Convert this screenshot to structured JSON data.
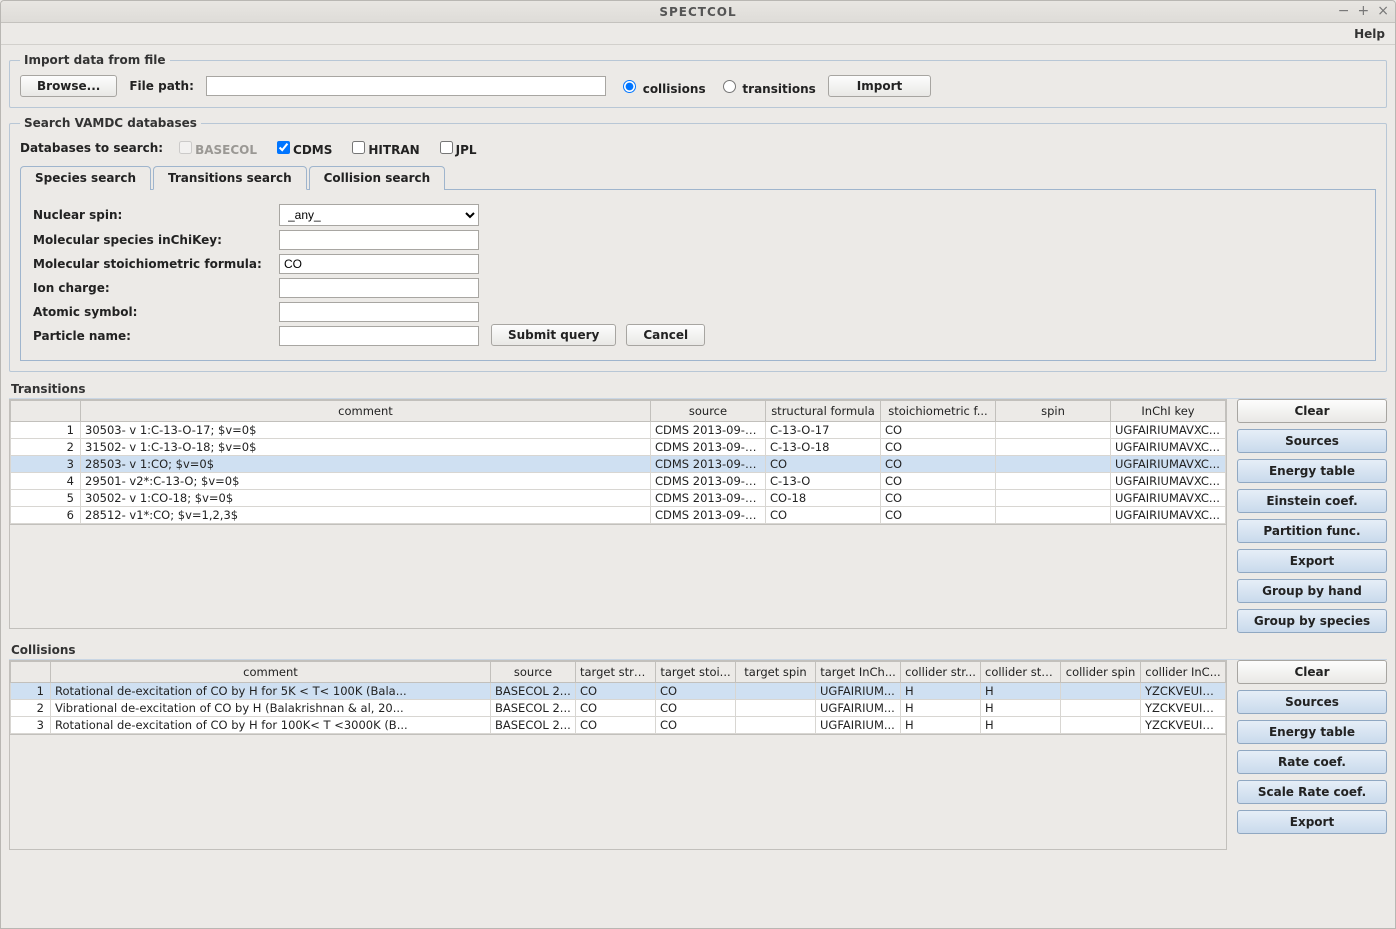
{
  "window": {
    "title": "SPECTCOL"
  },
  "menu": {
    "help": "Help"
  },
  "import_panel": {
    "legend": "Import data from file",
    "browse": "Browse...",
    "file_path_label": "File path:",
    "file_path_value": "",
    "radio_collisions": "collisions",
    "radio_transitions": "transitions",
    "import": "Import"
  },
  "search_panel": {
    "legend": "Search VAMDC databases",
    "db_label": "Databases to search:",
    "db": {
      "basecol": "BASECOL",
      "cdms": "CDMS",
      "hitran": "HITRAN",
      "jpl": "JPL"
    },
    "tabs": {
      "species": "Species search",
      "transitions": "Transitions search",
      "collision": "Collision search"
    },
    "form": {
      "nuclear_spin": "Nuclear spin:",
      "nuclear_spin_value": "_any_",
      "inchikey": "Molecular species inChiKey:",
      "inchikey_value": "",
      "stoich": "Molecular stoichiometric formula:",
      "stoich_value": "CO",
      "ion_charge": "Ion charge:",
      "ion_charge_value": "",
      "atomic_symbol": "Atomic symbol:",
      "atomic_symbol_value": "",
      "particle_name": "Particle name:",
      "particle_name_value": "",
      "submit": "Submit query",
      "cancel": "Cancel"
    }
  },
  "transitions": {
    "heading": "Transitions",
    "columns": [
      "",
      "comment",
      "source",
      "structural formula",
      "stoichiometric f...",
      "spin",
      "InChI key"
    ],
    "rows": [
      {
        "n": "1",
        "comment": "30503- v 1:C-13-O-17; $v=0$",
        "source": "CDMS 2013-09-0...",
        "structural": "C-13-O-17",
        "stoich": "CO",
        "spin": "",
        "inchi": "UGFAIRIUMAVXC..."
      },
      {
        "n": "2",
        "comment": "31502- v 1:C-13-O-18; $v=0$",
        "source": "CDMS 2013-09-0...",
        "structural": "C-13-O-18",
        "stoich": "CO",
        "spin": "",
        "inchi": "UGFAIRIUMAVXC..."
      },
      {
        "n": "3",
        "comment": "28503- v 1:CO; $v=0$",
        "source": "CDMS 2013-09-0...",
        "structural": "CO",
        "stoich": "CO",
        "spin": "",
        "inchi": "UGFAIRIUMAVXC...",
        "selected": true
      },
      {
        "n": "4",
        "comment": "29501- v2*:C-13-O; $v=0$",
        "source": "CDMS 2013-09-0...",
        "structural": "C-13-O",
        "stoich": "CO",
        "spin": "",
        "inchi": "UGFAIRIUMAVXC..."
      },
      {
        "n": "5",
        "comment": "30502- v 1:CO-18; $v=0$",
        "source": "CDMS 2013-09-0...",
        "structural": "CO-18",
        "stoich": "CO",
        "spin": "",
        "inchi": "UGFAIRIUMAVXC..."
      },
      {
        "n": "6",
        "comment": "28512- v1*:CO; $v=1,2,3$",
        "source": "CDMS 2013-09-0...",
        "structural": "CO",
        "stoich": "CO",
        "spin": "",
        "inchi": "UGFAIRIUMAVXC..."
      }
    ],
    "buttons": {
      "clear": "Clear",
      "sources": "Sources",
      "energy": "Energy table",
      "einstein": "Einstein coef.",
      "partition": "Partition func.",
      "export": "Export",
      "group_hand": "Group by hand",
      "group_species": "Group by species"
    }
  },
  "collisions": {
    "heading": "Collisions",
    "columns": [
      "",
      "comment",
      "source",
      "target stru...",
      "target stoi...",
      "target spin",
      "target InCh...",
      "collider str...",
      "collider sto...",
      "collider spin",
      "collider InC..."
    ],
    "rows": [
      {
        "n": "1",
        "comment": "Rotational de-excitation of CO by H for 5K < T< 100K (Bala...",
        "source": "BASECOL 2...",
        "tstru": "CO",
        "tstoi": "CO",
        "tspin": "",
        "tinch": "UGFAIRIUM...",
        "cstru": "H",
        "cstoi": "H",
        "cspin": "",
        "cinch": "YZCKVEUIG...",
        "selected": true
      },
      {
        "n": "2",
        "comment": "Vibrational de-excitation of CO by H (Balakrishnan & al, 20...",
        "source": "BASECOL 2...",
        "tstru": "CO",
        "tstoi": "CO",
        "tspin": "",
        "tinch": "UGFAIRIUM...",
        "cstru": "H",
        "cstoi": "H",
        "cspin": "",
        "cinch": "YZCKVEUIG..."
      },
      {
        "n": "3",
        "comment": "Rotational de-excitation of CO by H for 100K< T <3000K (B...",
        "source": "BASECOL 2...",
        "tstru": "CO",
        "tstoi": "CO",
        "tspin": "",
        "tinch": "UGFAIRIUM...",
        "cstru": "H",
        "cstoi": "H",
        "cspin": "",
        "cinch": "YZCKVEUIG..."
      }
    ],
    "buttons": {
      "clear": "Clear",
      "sources": "Sources",
      "energy": "Energy table",
      "rate": "Rate coef.",
      "scale": "Scale Rate coef.",
      "export": "Export"
    }
  }
}
